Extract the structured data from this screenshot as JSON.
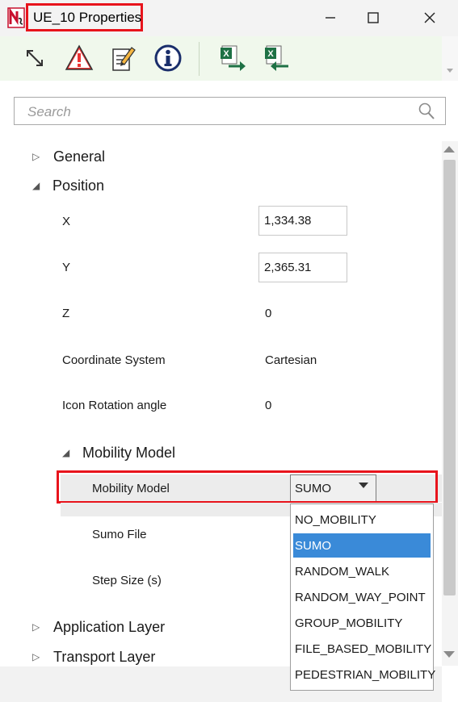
{
  "window": {
    "title": "UE_10 Properties",
    "minimize_label": "—",
    "maximize_label": "□",
    "close_label": "✕"
  },
  "colors": {
    "highlight_border": "#e8141c",
    "selected_item": "#3a8ad8",
    "toolbar_bg": "#f0f8ec"
  },
  "toolbar": {
    "buttons": [
      {
        "icon": "expand-icon"
      },
      {
        "icon": "warning-icon"
      },
      {
        "icon": "edit-notes-icon"
      },
      {
        "icon": "info-icon"
      },
      {
        "icon": "excel-export-icon"
      },
      {
        "icon": "excel-import-icon"
      }
    ]
  },
  "search": {
    "placeholder": "Search"
  },
  "groups": {
    "general": "General",
    "position": "Position",
    "mobility_model": "Mobility Model",
    "application_layer": "Application Layer",
    "transport_layer": "Transport Layer"
  },
  "position": {
    "x_label": "X",
    "x_value": "1,334.38",
    "y_label": "Y",
    "y_value": "2,365.31",
    "z_label": "Z",
    "z_value": "0",
    "coordinate_system_label": "Coordinate System",
    "coordinate_system_value": "Cartesian",
    "icon_rotation_label": "Icon Rotation angle",
    "icon_rotation_value": "0"
  },
  "mobility": {
    "model_label": "Mobility Model",
    "model_value": "SUMO",
    "sumo_file_label": "Sumo File",
    "step_size_label": "Step Size (s)",
    "options": [
      "NO_MOBILITY",
      "SUMO",
      "RANDOM_WALK",
      "RANDOM_WAY_POINT",
      "GROUP_MOBILITY",
      "FILE_BASED_MOBILITY",
      "PEDESTRIAN_MOBILITY"
    ],
    "selected_index": 1
  }
}
